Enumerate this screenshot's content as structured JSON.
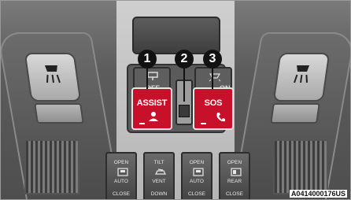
{
  "buttons": {
    "assist": {
      "label": "ASSIST",
      "color": "#c7112b"
    },
    "sos": {
      "label": "SOS",
      "color": "#c7112b"
    }
  },
  "caps": {
    "left_label": "OFF",
    "right_label": "ON"
  },
  "callouts": [
    "1",
    "2",
    "3"
  ],
  "switches": [
    {
      "top": "OPEN",
      "middle": "AUTO",
      "bottom": "CLOSE",
      "icon": "sunroof-icon"
    },
    {
      "top": "TILT",
      "middle": "VENT",
      "bottom": "DOWN",
      "icon": "car-vent-icon"
    },
    {
      "top": "OPEN",
      "middle": "AUTO",
      "bottom": "CLOSE",
      "icon": "sunroof-icon"
    },
    {
      "top": "OPEN",
      "middle": "REAR",
      "bottom": "CLOSE",
      "icon": "rear-shade-icon"
    }
  ],
  "reference_code": "A0414000176US"
}
